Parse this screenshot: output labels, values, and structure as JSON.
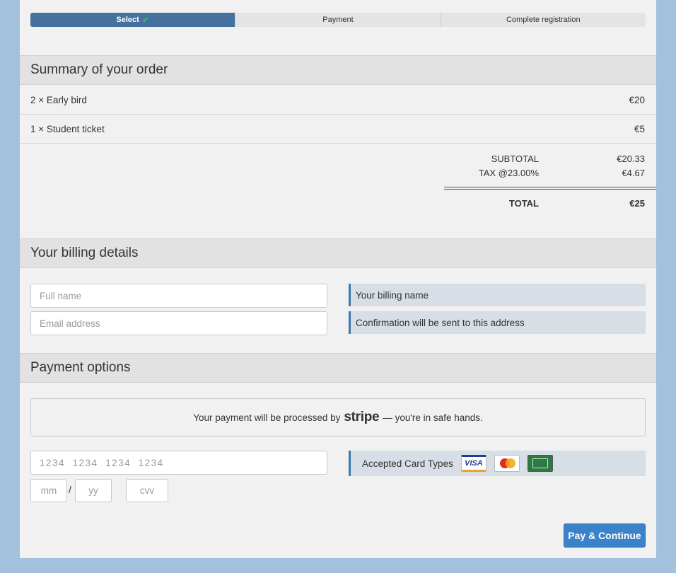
{
  "steps": [
    {
      "label": "Select"
    },
    {
      "label": "Payment"
    },
    {
      "label": "Complete registration"
    }
  ],
  "order": {
    "title": "Summary of your order",
    "items": [
      {
        "desc": "2 × Early bird",
        "price": "€20"
      },
      {
        "desc": "1 × Student ticket",
        "price": "€5"
      }
    ],
    "subtotal_label": "SUBTOTAL",
    "subtotal_value": "€20.33",
    "tax_label": "TAX @23.00%",
    "tax_value": "€4.67",
    "total_label": "TOTAL",
    "total_value": "€25"
  },
  "billing": {
    "title": "Your billing details",
    "name_placeholder": "Full name",
    "email_placeholder": "Email address",
    "name_hint": "Your billing name",
    "email_hint": "Confirmation will be sent to this address"
  },
  "payment": {
    "title": "Payment options",
    "notice_prefix": "Your payment will be processed by",
    "notice_brand": "stripe",
    "notice_suffix": "— you're in safe hands.",
    "card_placeholder": "1234  1234  1234  1234",
    "mm_placeholder": "mm",
    "separator": "/",
    "yy_placeholder": "yy",
    "cvv_placeholder": "cvv",
    "accepted_label": "Accepted Card Types",
    "cards": [
      {
        "icon": "visa-card-icon",
        "label": "VISA"
      },
      {
        "icon": "mastercard-icon"
      },
      {
        "icon": "amex-card-icon"
      }
    ],
    "submit_label": "Pay & Continue"
  },
  "colors": {
    "accent": "#3a82c9",
    "step_active": "#44719e",
    "background": "#a3c1dc"
  }
}
